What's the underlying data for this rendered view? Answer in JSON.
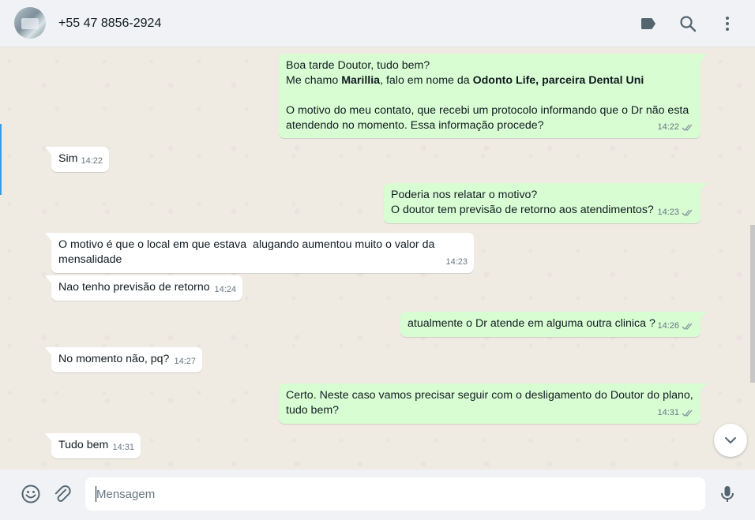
{
  "header": {
    "contact_name": "+55 47 8856-2924",
    "icons": [
      "label-icon",
      "search-icon",
      "menu-icon"
    ]
  },
  "messages": [
    {
      "dir": "out",
      "lines": [
        [
          "Boa tarde Doutor, tudo bem?"
        ],
        [
          "Me chamo ",
          {
            "b": "Marillia"
          },
          ", falo em nome da ",
          {
            "b": "Odonto Life, parceira Dental Uni"
          }
        ],
        [
          ""
        ],
        [
          "O motivo do meu contato, que recebi um protocolo informando que o Dr não esta"
        ],
        [
          "atendendo no momento. Essa informação procede?"
        ]
      ],
      "time": "14:22"
    },
    {
      "dir": "in",
      "text": "Sim",
      "time": "14:22"
    },
    {
      "dir": "out",
      "lines": [
        [
          "Poderia nos relatar o motivo?"
        ],
        [
          "O doutor tem previsão de retorno aos atendimentos?"
        ]
      ],
      "time": "14:23"
    },
    {
      "dir": "in",
      "text": "O motivo é que o local em que estava  alugando aumentou muito o valor da\nmensalidade",
      "time": "14:23"
    },
    {
      "dir": "in",
      "text": "Nao tenho previsão de retorno",
      "time": "14:24"
    },
    {
      "dir": "out",
      "lines": [
        [
          "atualmente o Dr atende em alguma outra clinica ?"
        ]
      ],
      "time": "14:26"
    },
    {
      "dir": "in",
      "text": "No momento não, pq?",
      "time": "14:27"
    },
    {
      "dir": "out",
      "lines": [
        [
          "Certo. Neste caso vamos precisar seguir com o desligamento do Doutor do plano,"
        ],
        [
          "tudo bem?"
        ]
      ],
      "time": "14:31"
    },
    {
      "dir": "in",
      "text": "Tudo bem",
      "time": "14:31"
    }
  ],
  "composer": {
    "placeholder": "Mensagem",
    "value": "",
    "icons": [
      "emoji-icon",
      "attach-icon",
      "mic-icon"
    ]
  },
  "colors": {
    "incoming_bubble": "#ffffff",
    "outgoing_bubble": "#d9fdd3",
    "chat_background": "#efeae2",
    "header_background": "#f0f2f5",
    "ticks": "#8696a0"
  }
}
